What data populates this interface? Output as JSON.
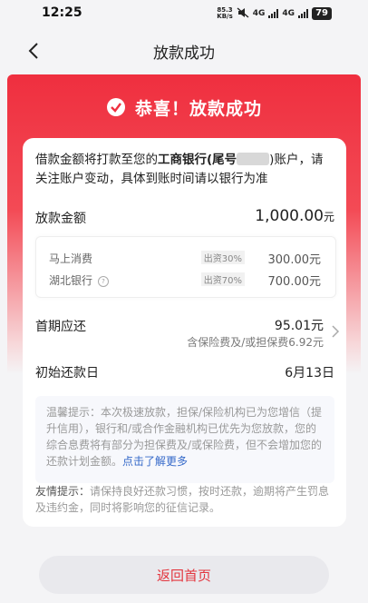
{
  "status_bar": {
    "time": "12:25",
    "speed_value": "85.3",
    "speed_unit": "KB/s",
    "network_1": "4G",
    "network_2": "4G",
    "battery": "79"
  },
  "nav": {
    "title": "放款成功"
  },
  "banner": {
    "message": "恭喜！放款成功"
  },
  "notice": {
    "prefix": "借款金额将打款至您的",
    "bank": "工商银行(尾号",
    "suffix": ")账户，请关注账户变动，具体到账时间请以银行为准"
  },
  "amount": {
    "label": "放款金额",
    "value": "1,000.00",
    "unit": "元"
  },
  "lenders": [
    {
      "name": "马上消费",
      "ratio": "出资30%",
      "value": "300.00元"
    },
    {
      "name": "湖北银行",
      "ratio": "出资70%",
      "value": "700.00元"
    }
  ],
  "first_payment": {
    "label": "首期应还",
    "value": "95.01元",
    "sub": "含保险费及/或担保费6.92元"
  },
  "start_date": {
    "label": "初始还款日",
    "value": "6月13日"
  },
  "warm_tip": {
    "text": "温馨提示：本次极速放款，担保/保险机构已为您增信（提升信用），银行和/或合作金融机构已优先为您放款，您的综合息费将有部分为担保费及/或保险费，但不会增加您的还款计划金额。",
    "link": "点击了解更多"
  },
  "friendly_tip": {
    "label": "友情提示：",
    "text": "请保持良好还款习惯，按时还款，逾期将产生罚息及违约金，同时将影响您的征信记录。"
  },
  "home_button": {
    "label": "返回首页"
  },
  "colors": {
    "brand_red": "#ef2f3f",
    "link_blue": "#3569c9"
  }
}
